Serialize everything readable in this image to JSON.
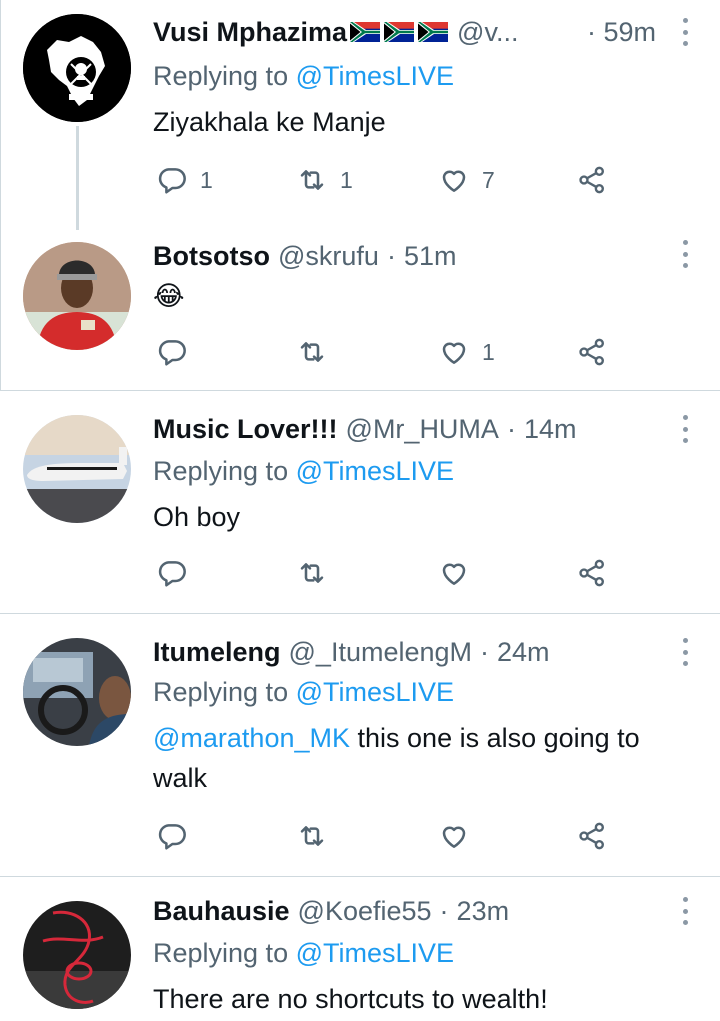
{
  "colors": {
    "accent": "#1d9bf0",
    "muted": "#536471",
    "text": "#0f1419",
    "divider": "#cfd9de"
  },
  "tweets": [
    {
      "name": "Vusi Mphazima",
      "flags": [
        "south-africa-flag",
        "south-africa-flag",
        "south-africa-flag"
      ],
      "handle": "@v...",
      "time": "· 59m",
      "replying_prefix": "Replying to",
      "replying_to": "@TimesLIVE",
      "text": "Ziyakhala ke Manje",
      "reply_count": "1",
      "retweet_count": "1",
      "like_count": "7"
    },
    {
      "name": "Botsotso",
      "handle": "@skrufu",
      "time": "51m",
      "text": "😂",
      "reply_count": "",
      "retweet_count": "",
      "like_count": "1"
    },
    {
      "name": "Music Lover!!!",
      "handle": "@Mr_HUMA",
      "time": "14m",
      "replying_prefix": "Replying to",
      "replying_to": "@TimesLIVE",
      "text": "Oh boy",
      "reply_count": "",
      "retweet_count": "",
      "like_count": ""
    },
    {
      "name": "Itumeleng",
      "handle": "@_ItumelengM",
      "time": "24m",
      "replying_prefix": "Replying to",
      "replying_to": "@TimesLIVE",
      "mention": "@marathon_MK",
      "text_line1": "this one is also going to",
      "text_line2": "walk",
      "reply_count": "",
      "retweet_count": "",
      "like_count": ""
    },
    {
      "name": "Bauhausie",
      "handle": "@Koefie55",
      "time": "23m",
      "replying_prefix": "Replying to",
      "replying_to": "@TimesLIVE",
      "text": "There are no shortcuts to wealth!"
    }
  ]
}
